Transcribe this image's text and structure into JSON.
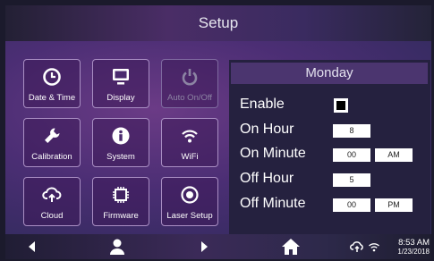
{
  "header": {
    "title": "Setup"
  },
  "tiles": [
    {
      "label": "Date & Time",
      "icon": "clock-icon",
      "enabled": true
    },
    {
      "label": "Display",
      "icon": "monitor-icon",
      "enabled": true
    },
    {
      "label": "Auto On/Off",
      "icon": "power-icon",
      "enabled": false
    },
    {
      "label": "Calibration",
      "icon": "wrench-icon",
      "enabled": true
    },
    {
      "label": "System",
      "icon": "info-icon",
      "enabled": true
    },
    {
      "label": "WiFi",
      "icon": "wifi-icon",
      "enabled": true
    },
    {
      "label": "Cloud",
      "icon": "cloud-icon",
      "enabled": true
    },
    {
      "label": "Firmware",
      "icon": "chip-icon",
      "enabled": true
    },
    {
      "label": "Laser Setup",
      "icon": "laser-icon",
      "enabled": true
    }
  ],
  "schedule": {
    "day": "Monday",
    "enable_label": "Enable",
    "enabled": true,
    "on_hour_label": "On Hour",
    "on_hour": "8",
    "on_minute_label": "On Minute",
    "on_minute": "00",
    "on_ampm": "AM",
    "off_hour_label": "Off Hour",
    "off_hour": "5",
    "off_minute_label": "Off Minute",
    "off_minute": "00",
    "off_ampm": "PM"
  },
  "status": {
    "time": "8:53 AM",
    "date": "1/23/2018"
  },
  "colors": {
    "accent": "#4b356f",
    "tile_border": "#a98ec3",
    "disabled_text": "#8c84a3"
  }
}
